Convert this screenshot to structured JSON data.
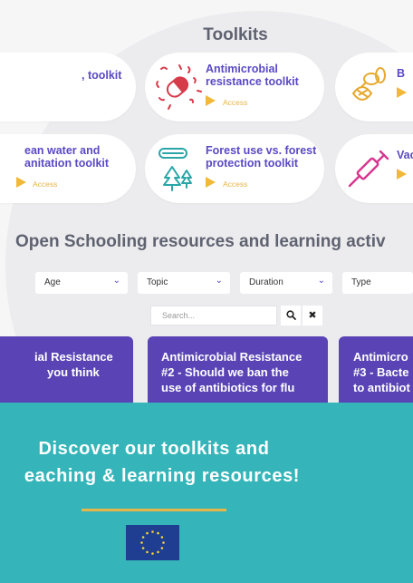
{
  "toolkits": {
    "title": "Toolkits",
    "cards": [
      {
        "line1": "",
        "line2": "toolkit",
        "access": ""
      },
      {
        "line1": "Antimicrobial",
        "line2": "resistance toolkit",
        "access": "Access"
      },
      {
        "line1": "B",
        "line2": "",
        "access": ""
      },
      {
        "line1": "ean water and",
        "line2": "anitation toolkit",
        "access": "Access"
      },
      {
        "line1": "Forest use vs. forest",
        "line2": "protection toolkit",
        "access": "Access"
      },
      {
        "line1": "Vac",
        "line2": "",
        "access": ""
      }
    ]
  },
  "resources": {
    "section_title": "Open Schooling resources and learning activ",
    "filters": [
      {
        "label": "Age"
      },
      {
        "label": "Topic"
      },
      {
        "label": "Duration"
      },
      {
        "label": "Type"
      }
    ],
    "search": {
      "placeholder": "Search..."
    },
    "cards": [
      {
        "l1": "ial Resistance",
        "l2": "you think",
        "l3": ""
      },
      {
        "l1": "Antimicrobial Resistance",
        "l2": "#2 - Should we ban the",
        "l3": "use of antibiotics for flu"
      },
      {
        "l1": "Antimicro",
        "l2": "#3 - Bacte",
        "l3": "to antibiot"
      }
    ]
  },
  "banner": {
    "line1": "Discover our toolkits and",
    "line2": "eaching & learning resources!"
  },
  "colors": {
    "accent": "#5a43b5",
    "banner": "#35b5b9",
    "gold": "#e7b64a",
    "eu_blue": "#1f3e92"
  }
}
